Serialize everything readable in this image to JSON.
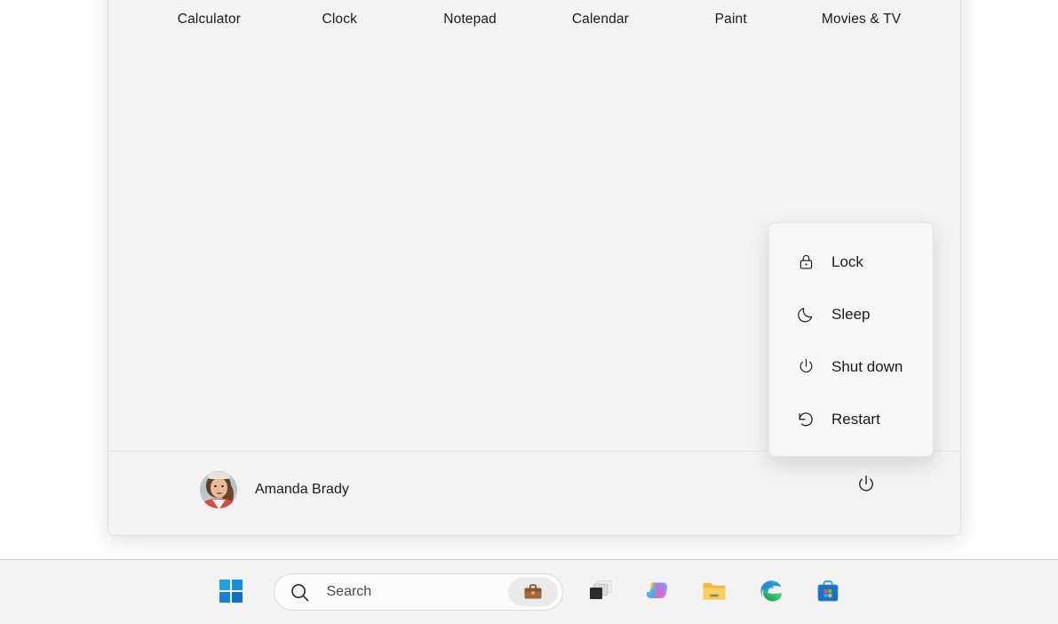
{
  "start_menu": {
    "pinned_apps": [
      {
        "label": "Calculator",
        "icon": "calculator-icon"
      },
      {
        "label": "Clock",
        "icon": "clock-icon"
      },
      {
        "label": "Notepad",
        "icon": "notepad-icon"
      },
      {
        "label": "Calendar",
        "icon": "calendar-icon"
      },
      {
        "label": "Paint",
        "icon": "paint-icon"
      },
      {
        "label": "Movies & TV",
        "icon": "movies-and-tv-icon"
      }
    ],
    "account": {
      "name": "Amanda Brady",
      "avatar": "user-avatar-photo"
    },
    "power_button_icon": "power-icon"
  },
  "power_flyout": {
    "items": [
      {
        "label": "Lock",
        "icon": "lock-icon"
      },
      {
        "label": "Sleep",
        "icon": "moon-icon"
      },
      {
        "label": "Shut down",
        "icon": "power-icon"
      },
      {
        "label": "Restart",
        "icon": "restart-icon"
      }
    ]
  },
  "taskbar": {
    "start_button_icon": "windows-logo-icon",
    "search": {
      "placeholder": "Search",
      "icon": "search-icon",
      "badge_icon": "briefcase-icon"
    },
    "buttons": [
      {
        "name": "task-view",
        "icon": "task-view-icon"
      },
      {
        "name": "copilot",
        "icon": "copilot-icon"
      },
      {
        "name": "file-explorer",
        "icon": "folder-icon"
      },
      {
        "name": "microsoft-edge",
        "icon": "edge-icon"
      },
      {
        "name": "microsoft-store",
        "icon": "store-icon"
      }
    ]
  },
  "colors": {
    "panel_bg": "#f3f3f3",
    "flyout_bg": "#f7f7f7",
    "taskbar_bg": "#f3f3f3",
    "desktop_bg": "#ffffff",
    "text": "#1b1b1b",
    "accent_blue": "#0078d4"
  }
}
